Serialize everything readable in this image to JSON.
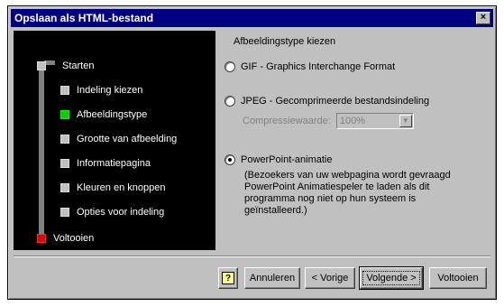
{
  "window": {
    "title": "Opslaan als HTML-bestand",
    "close_label": "×"
  },
  "steps": [
    {
      "label": "Starten",
      "state": "start"
    },
    {
      "label": "Indeling kiezen",
      "state": "normal"
    },
    {
      "label": "Afbeeldingstype",
      "state": "active"
    },
    {
      "label": "Grootte van afbeelding",
      "state": "normal"
    },
    {
      "label": "Informatiepagina",
      "state": "normal"
    },
    {
      "label": "Kleuren en knoppen",
      "state": "normal"
    },
    {
      "label": "Opties voor indeling",
      "state": "normal"
    },
    {
      "label": "Voltooien",
      "state": "end"
    }
  ],
  "image_type": {
    "title": "Afbeeldingstype kiezen",
    "options": [
      {
        "label": "GIF - Graphics Interchange Format",
        "checked": false
      },
      {
        "label": "JPEG - Gecomprimeerde bestandsindeling",
        "checked": false
      },
      {
        "label": "PowerPoint-animatie",
        "checked": true
      }
    ],
    "quality_label": "Compressiewaarde:",
    "quality_value": "100%",
    "description": "(Bezoekers van uw webpagina wordt gevraagd PowerPoint Animatiespeler te laden als dit programma nog niet op hun systeem is geïnstalleerd.)"
  },
  "buttons": {
    "help": "?",
    "cancel": "Annuleren",
    "back": "< Vorige",
    "next": "Volgende >",
    "finish": "Voltooien"
  }
}
